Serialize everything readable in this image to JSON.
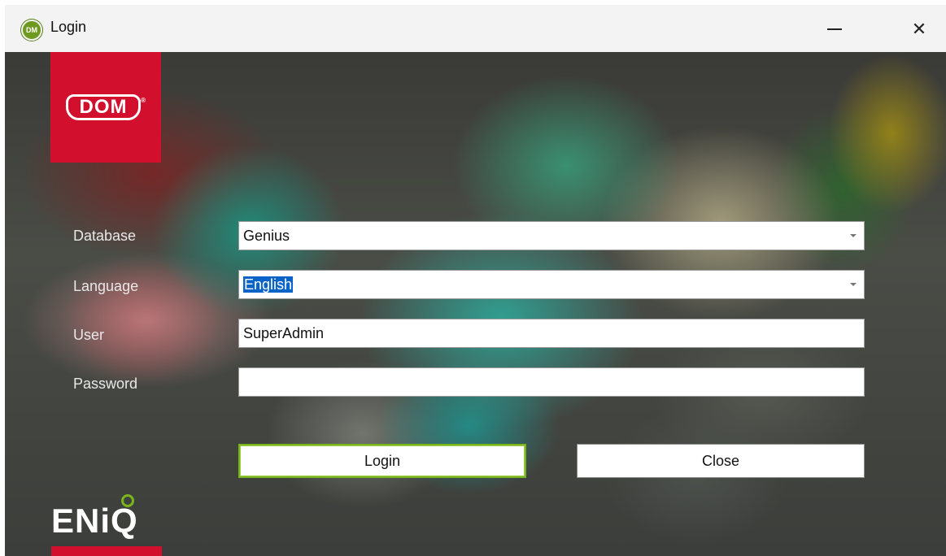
{
  "window": {
    "title": "Login",
    "app_icon_text": "DM",
    "minimize_glyph": "—",
    "close_glyph": "✕"
  },
  "branding": {
    "top_logo_text": "DOM",
    "top_logo_reg": "®",
    "bottom_logo_text": "ENiQ",
    "brand_red": "#d20f2d",
    "brand_green": "#7ab51d"
  },
  "form": {
    "database": {
      "label": "Database",
      "value": "Genius"
    },
    "language": {
      "label": "Language",
      "value": "English"
    },
    "user": {
      "label": "User",
      "value": "SuperAdmin"
    },
    "password": {
      "label": "Password",
      "value": ""
    }
  },
  "buttons": {
    "login": "Login",
    "close": "Close"
  },
  "icons": {
    "app": "dom-app-icon",
    "minimize": "minimize-icon",
    "close": "close-icon",
    "dropdown": "chevron-down-icon"
  }
}
